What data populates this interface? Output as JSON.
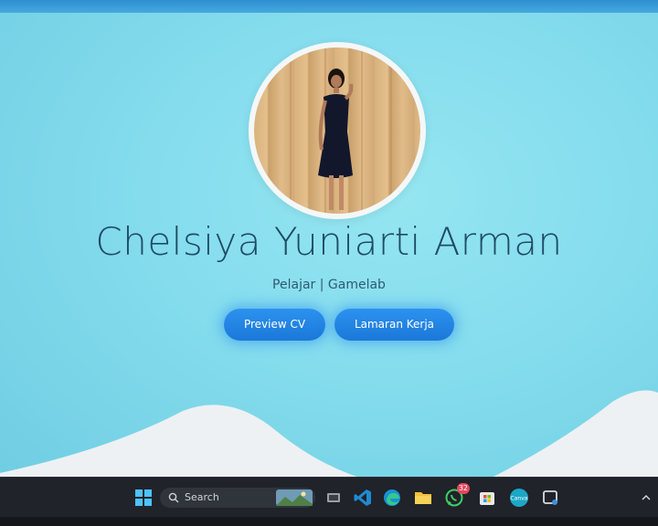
{
  "profile": {
    "name": "Chelsiya Yuniarti Arman",
    "subtitle": "Pelajar | Gamelab"
  },
  "buttons": {
    "preview_cv": "Preview CV",
    "lamaran_kerja": "Lamaran Kerja"
  },
  "colors": {
    "background": "#84dced",
    "top_bar": "#2d8fd0",
    "button": "#1b78d8",
    "name_text": "#1f4b66",
    "wave": "#eef1f3"
  },
  "taskbar": {
    "search_placeholder": "Search",
    "apps": [
      {
        "icon": "windows-start-icon"
      },
      {
        "icon": "search-icon"
      },
      {
        "icon": "landscape-widget-icon"
      },
      {
        "icon": "task-view-icon"
      },
      {
        "icon": "vscode-icon"
      },
      {
        "icon": "edge-browser-icon"
      },
      {
        "icon": "file-explorer-icon"
      },
      {
        "icon": "whatsapp-icon",
        "badge": "32"
      },
      {
        "icon": "microsoft-store-icon"
      },
      {
        "icon": "canva-icon",
        "label": "Canva"
      },
      {
        "icon": "snipping-tool-icon"
      },
      {
        "icon": "chevron-up-icon"
      }
    ]
  }
}
